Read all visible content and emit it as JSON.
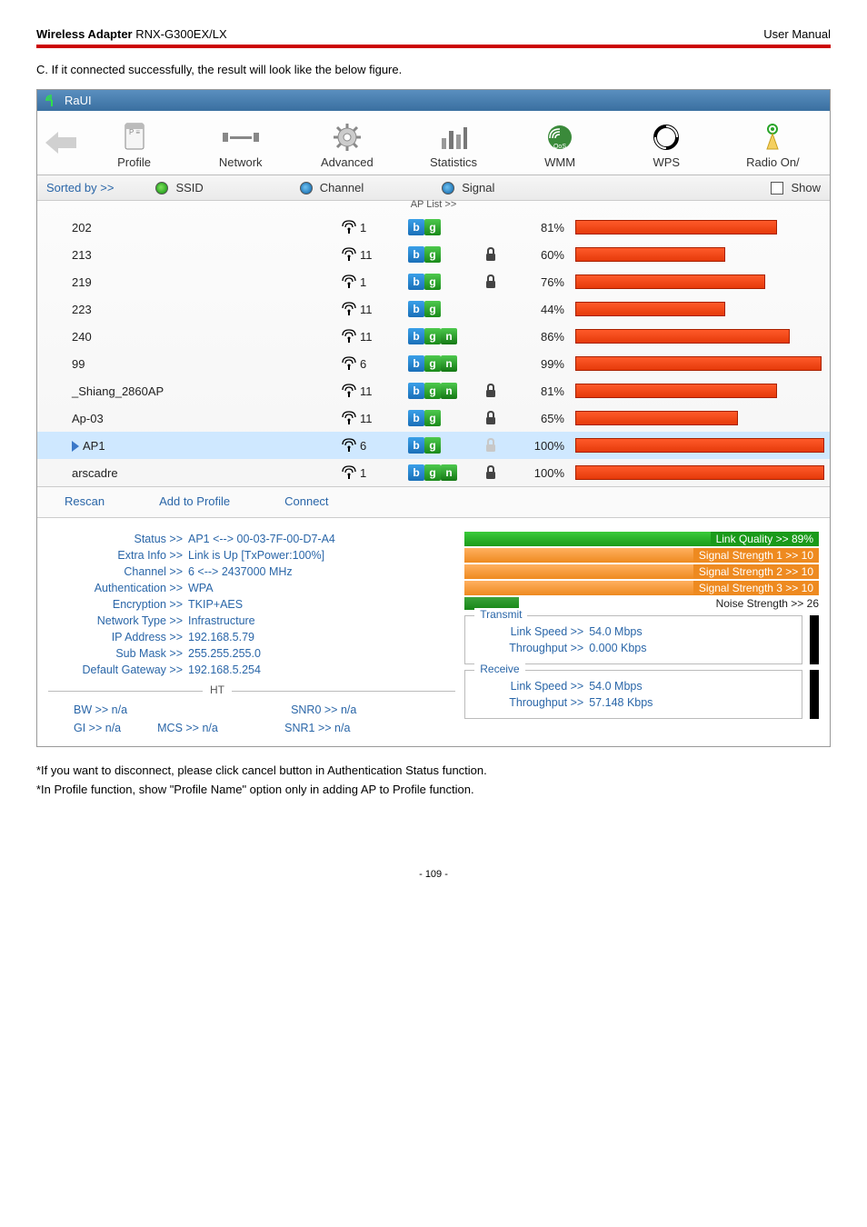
{
  "header": {
    "title_bold": "Wireless Adapter",
    "title_rest": " RNX-G300EX/LX",
    "right": "User Manual"
  },
  "intro": "C. If it connected successfully, the result will look like the below figure.",
  "window_title": "RaUI",
  "tabs": {
    "profile": "Profile",
    "network": "Network",
    "advanced": "Advanced",
    "statistics": "Statistics",
    "wmm": "WMM",
    "wps": "WPS",
    "radio": "Radio On/"
  },
  "sort_row": {
    "sorted_by": "Sorted by >>",
    "ssid": "SSID",
    "channel": "Channel",
    "signal": "Signal",
    "show": "Show"
  },
  "ap_list_label": "AP List >>",
  "ap_rows": [
    {
      "ssid": "202",
      "ch": "1",
      "modes": [
        "b",
        "g"
      ],
      "enc": false,
      "signal": "81%",
      "bar": 81
    },
    {
      "ssid": "213",
      "ch": "11",
      "modes": [
        "b",
        "g"
      ],
      "enc": true,
      "signal": "60%",
      "bar": 60
    },
    {
      "ssid": "219",
      "ch": "1",
      "modes": [
        "b",
        "g"
      ],
      "enc": true,
      "signal": "76%",
      "bar": 76
    },
    {
      "ssid": "223",
      "ch": "11",
      "modes": [
        "b",
        "g"
      ],
      "enc": false,
      "signal": "44%",
      "bar": 60
    },
    {
      "ssid": "240",
      "ch": "11",
      "modes": [
        "b",
        "g",
        "n"
      ],
      "enc": false,
      "signal": "86%",
      "bar": 86
    },
    {
      "ssid": "99",
      "ch": "6",
      "modes": [
        "b",
        "g",
        "n"
      ],
      "enc": false,
      "signal": "99%",
      "bar": 99
    },
    {
      "ssid": "_Shiang_2860AP",
      "ch": "11",
      "modes": [
        "b",
        "g",
        "n"
      ],
      "enc": true,
      "signal": "81%",
      "bar": 81
    },
    {
      "ssid": "Ap-03",
      "ch": "11",
      "modes": [
        "b",
        "g"
      ],
      "enc": true,
      "signal": "65%",
      "bar": 65
    },
    {
      "ssid": "AP1",
      "ch": "6",
      "modes": [
        "b",
        "g"
      ],
      "enc": true,
      "signal": "100%",
      "bar": 100,
      "selected": true
    },
    {
      "ssid": "arscadre",
      "ch": "1",
      "modes": [
        "b",
        "g",
        "n"
      ],
      "enc": true,
      "signal": "100%",
      "bar": 100
    }
  ],
  "actions": {
    "rescan": "Rescan",
    "add": "Add to Profile",
    "connect": "Connect"
  },
  "status_left": [
    {
      "label": "Status >>",
      "value": "AP1 <--> 00-03-7F-00-D7-A4"
    },
    {
      "label": "Extra Info >>",
      "value": "Link is Up [TxPower:100%]"
    },
    {
      "label": "Channel >>",
      "value": "6 <--> 2437000 MHz"
    },
    {
      "label": "Authentication >>",
      "value": "WPA"
    },
    {
      "label": "Encryption >>",
      "value": "TKIP+AES"
    },
    {
      "label": "Network Type >>",
      "value": "Infrastructure"
    },
    {
      "label": "IP Address >>",
      "value": "192.168.5.79"
    },
    {
      "label": "Sub Mask >>",
      "value": "255.255.255.0"
    },
    {
      "label": "Default Gateway >>",
      "value": "192.168.5.254"
    }
  ],
  "quality": {
    "link": "Link Quality >> 89%",
    "sig1": "Signal Strength 1 >> 10",
    "sig2": "Signal Strength 2 >> 10",
    "sig3": "Signal Strength 3 >> 10",
    "noise": "Noise Strength >> 26"
  },
  "transmit": {
    "title": "Transmit",
    "speed_l": "Link Speed >>",
    "speed_v": "54.0 Mbps",
    "thr_l": "Throughput >>",
    "thr_v": "0.000 Kbps"
  },
  "receive": {
    "title": "Receive",
    "speed_l": "Link Speed >>",
    "speed_v": "54.0 Mbps",
    "thr_l": "Throughput >>",
    "thr_v": "57.148 Kbps"
  },
  "ht": {
    "title": "HT",
    "bw": "BW >> n/a",
    "gi": "GI >> n/a",
    "mcs": "MCS >> n/a",
    "snr0": "SNR0 >> n/a",
    "snr1": "SNR1 >> n/a"
  },
  "footer": {
    "note1": "*If you want to disconnect, please click cancel button in Authentication Status function.",
    "note2": "*In Profile function, show \"Profile Name\" option only in adding AP to Profile function."
  },
  "page_number": "- 109 -"
}
